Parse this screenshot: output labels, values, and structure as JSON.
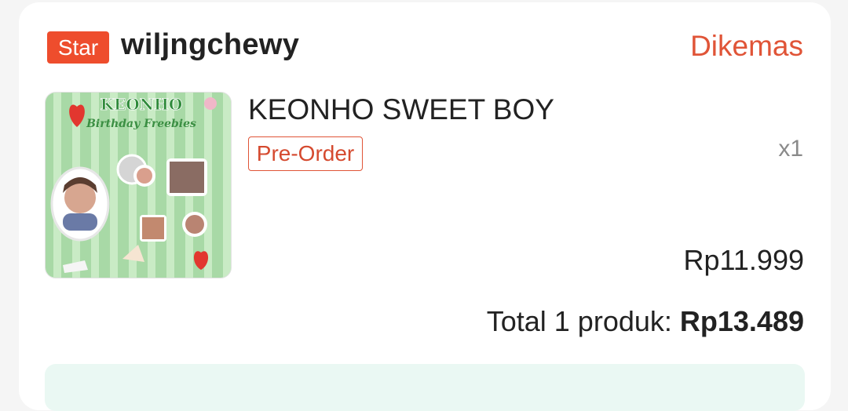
{
  "order": {
    "shop_badge": "Star",
    "shop_name": "wiljngchewy",
    "status": "Dikemas",
    "status_color": "#e05437",
    "product": {
      "title": "KEONHO SWEET BOY",
      "tag": "Pre-Order",
      "quantity": "x1",
      "price": "Rp11.999",
      "image": {
        "title_line1": "KEONHO",
        "title_line2": "Birthday Freebies"
      }
    },
    "total_label": "Total 1 produk: ",
    "total_amount": "Rp13.489"
  },
  "colors": {
    "brand_orange": "#ee4d2d",
    "info_box_bg": "#eaf8f3"
  }
}
